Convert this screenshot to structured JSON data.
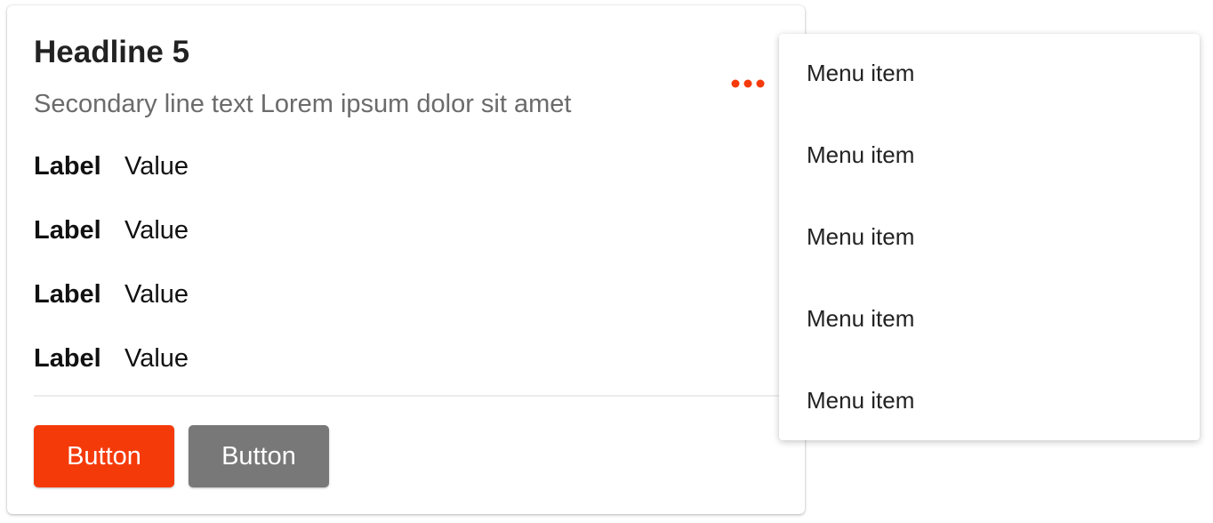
{
  "card": {
    "headline": "Headline 5",
    "subtitle": "Secondary line text Lorem ipsum dolor sit amet",
    "more_icon": "more-horizontal-icon",
    "accent_color": "#f53a0a",
    "fields": [
      {
        "label": "Label",
        "value": "Value"
      },
      {
        "label": "Label",
        "value": "Value"
      },
      {
        "label": "Label",
        "value": "Value"
      },
      {
        "label": "Label",
        "value": "Value"
      }
    ],
    "primary_button": "Button",
    "secondary_button": "Button",
    "primary_color": "#f53a0a",
    "secondary_color": "#787878"
  },
  "menu": {
    "items": [
      {
        "label": "Menu item"
      },
      {
        "label": "Menu item"
      },
      {
        "label": "Menu item"
      },
      {
        "label": "Menu item"
      },
      {
        "label": "Menu item"
      }
    ]
  }
}
